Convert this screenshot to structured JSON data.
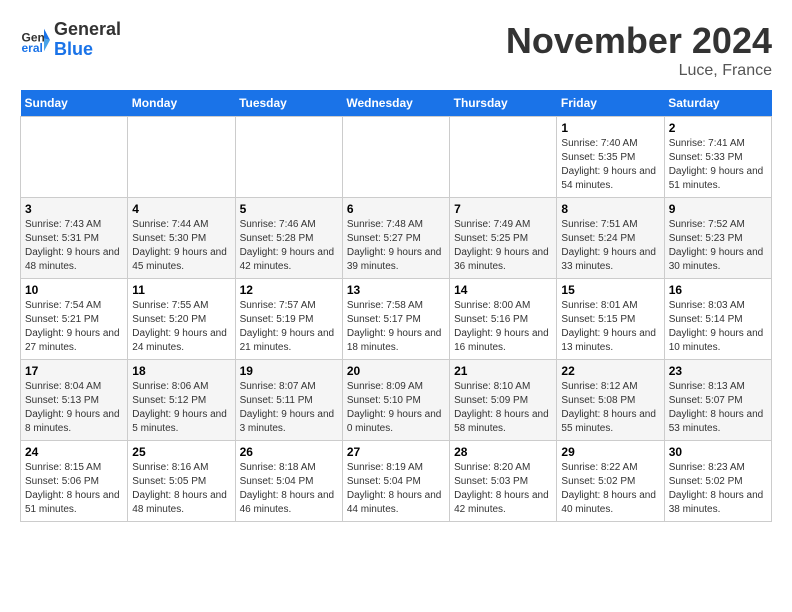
{
  "header": {
    "logo_line1": "General",
    "logo_line2": "Blue",
    "month_title": "November 2024",
    "location": "Luce, France"
  },
  "weekdays": [
    "Sunday",
    "Monday",
    "Tuesday",
    "Wednesday",
    "Thursday",
    "Friday",
    "Saturday"
  ],
  "weeks": [
    [
      {
        "day": "",
        "info": ""
      },
      {
        "day": "",
        "info": ""
      },
      {
        "day": "",
        "info": ""
      },
      {
        "day": "",
        "info": ""
      },
      {
        "day": "",
        "info": ""
      },
      {
        "day": "1",
        "info": "Sunrise: 7:40 AM\nSunset: 5:35 PM\nDaylight: 9 hours and 54 minutes."
      },
      {
        "day": "2",
        "info": "Sunrise: 7:41 AM\nSunset: 5:33 PM\nDaylight: 9 hours and 51 minutes."
      }
    ],
    [
      {
        "day": "3",
        "info": "Sunrise: 7:43 AM\nSunset: 5:31 PM\nDaylight: 9 hours and 48 minutes."
      },
      {
        "day": "4",
        "info": "Sunrise: 7:44 AM\nSunset: 5:30 PM\nDaylight: 9 hours and 45 minutes."
      },
      {
        "day": "5",
        "info": "Sunrise: 7:46 AM\nSunset: 5:28 PM\nDaylight: 9 hours and 42 minutes."
      },
      {
        "day": "6",
        "info": "Sunrise: 7:48 AM\nSunset: 5:27 PM\nDaylight: 9 hours and 39 minutes."
      },
      {
        "day": "7",
        "info": "Sunrise: 7:49 AM\nSunset: 5:25 PM\nDaylight: 9 hours and 36 minutes."
      },
      {
        "day": "8",
        "info": "Sunrise: 7:51 AM\nSunset: 5:24 PM\nDaylight: 9 hours and 33 minutes."
      },
      {
        "day": "9",
        "info": "Sunrise: 7:52 AM\nSunset: 5:23 PM\nDaylight: 9 hours and 30 minutes."
      }
    ],
    [
      {
        "day": "10",
        "info": "Sunrise: 7:54 AM\nSunset: 5:21 PM\nDaylight: 9 hours and 27 minutes."
      },
      {
        "day": "11",
        "info": "Sunrise: 7:55 AM\nSunset: 5:20 PM\nDaylight: 9 hours and 24 minutes."
      },
      {
        "day": "12",
        "info": "Sunrise: 7:57 AM\nSunset: 5:19 PM\nDaylight: 9 hours and 21 minutes."
      },
      {
        "day": "13",
        "info": "Sunrise: 7:58 AM\nSunset: 5:17 PM\nDaylight: 9 hours and 18 minutes."
      },
      {
        "day": "14",
        "info": "Sunrise: 8:00 AM\nSunset: 5:16 PM\nDaylight: 9 hours and 16 minutes."
      },
      {
        "day": "15",
        "info": "Sunrise: 8:01 AM\nSunset: 5:15 PM\nDaylight: 9 hours and 13 minutes."
      },
      {
        "day": "16",
        "info": "Sunrise: 8:03 AM\nSunset: 5:14 PM\nDaylight: 9 hours and 10 minutes."
      }
    ],
    [
      {
        "day": "17",
        "info": "Sunrise: 8:04 AM\nSunset: 5:13 PM\nDaylight: 9 hours and 8 minutes."
      },
      {
        "day": "18",
        "info": "Sunrise: 8:06 AM\nSunset: 5:12 PM\nDaylight: 9 hours and 5 minutes."
      },
      {
        "day": "19",
        "info": "Sunrise: 8:07 AM\nSunset: 5:11 PM\nDaylight: 9 hours and 3 minutes."
      },
      {
        "day": "20",
        "info": "Sunrise: 8:09 AM\nSunset: 5:10 PM\nDaylight: 9 hours and 0 minutes."
      },
      {
        "day": "21",
        "info": "Sunrise: 8:10 AM\nSunset: 5:09 PM\nDaylight: 8 hours and 58 minutes."
      },
      {
        "day": "22",
        "info": "Sunrise: 8:12 AM\nSunset: 5:08 PM\nDaylight: 8 hours and 55 minutes."
      },
      {
        "day": "23",
        "info": "Sunrise: 8:13 AM\nSunset: 5:07 PM\nDaylight: 8 hours and 53 minutes."
      }
    ],
    [
      {
        "day": "24",
        "info": "Sunrise: 8:15 AM\nSunset: 5:06 PM\nDaylight: 8 hours and 51 minutes."
      },
      {
        "day": "25",
        "info": "Sunrise: 8:16 AM\nSunset: 5:05 PM\nDaylight: 8 hours and 48 minutes."
      },
      {
        "day": "26",
        "info": "Sunrise: 8:18 AM\nSunset: 5:04 PM\nDaylight: 8 hours and 46 minutes."
      },
      {
        "day": "27",
        "info": "Sunrise: 8:19 AM\nSunset: 5:04 PM\nDaylight: 8 hours and 44 minutes."
      },
      {
        "day": "28",
        "info": "Sunrise: 8:20 AM\nSunset: 5:03 PM\nDaylight: 8 hours and 42 minutes."
      },
      {
        "day": "29",
        "info": "Sunrise: 8:22 AM\nSunset: 5:02 PM\nDaylight: 8 hours and 40 minutes."
      },
      {
        "day": "30",
        "info": "Sunrise: 8:23 AM\nSunset: 5:02 PM\nDaylight: 8 hours and 38 minutes."
      }
    ]
  ]
}
